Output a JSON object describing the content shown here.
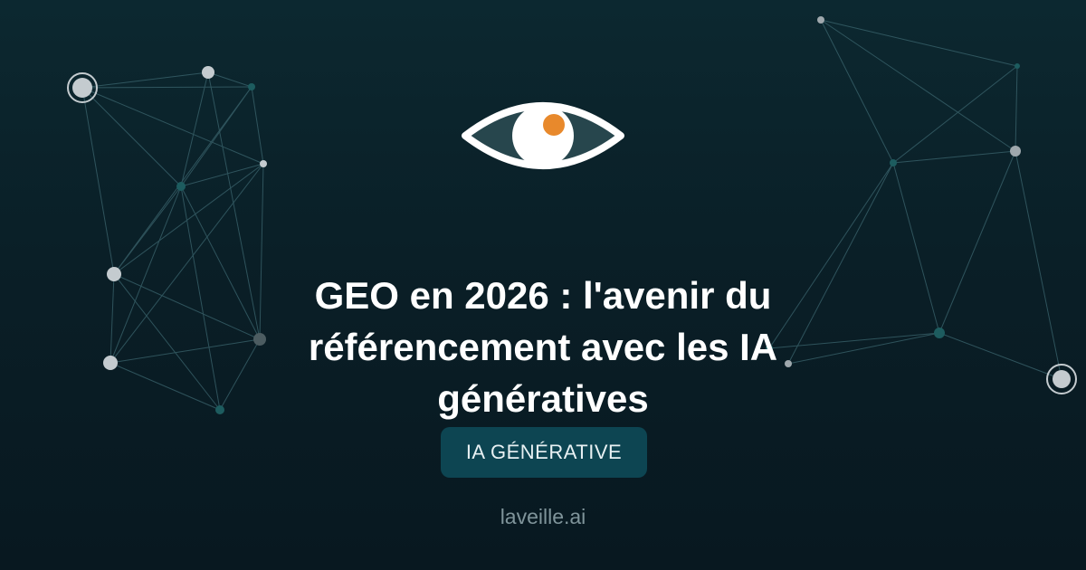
{
  "title": "GEO en 2026 : l'avenir du référencement avec les IA génératives",
  "category": "IA GÉNÉRATIVE",
  "site": "laveille.ai",
  "logo": {
    "icon": "eye-icon",
    "pupil_color": "#e8892c",
    "iris_color": "#ffffff",
    "outline_color": "#ffffff"
  },
  "colors": {
    "background_top": "#0c2830",
    "background_bottom": "#081820",
    "badge_background": "#0d4552",
    "network_line": "#3f6a73",
    "node_light": "#c4cbcf",
    "node_dark": "#1d5c5f"
  }
}
